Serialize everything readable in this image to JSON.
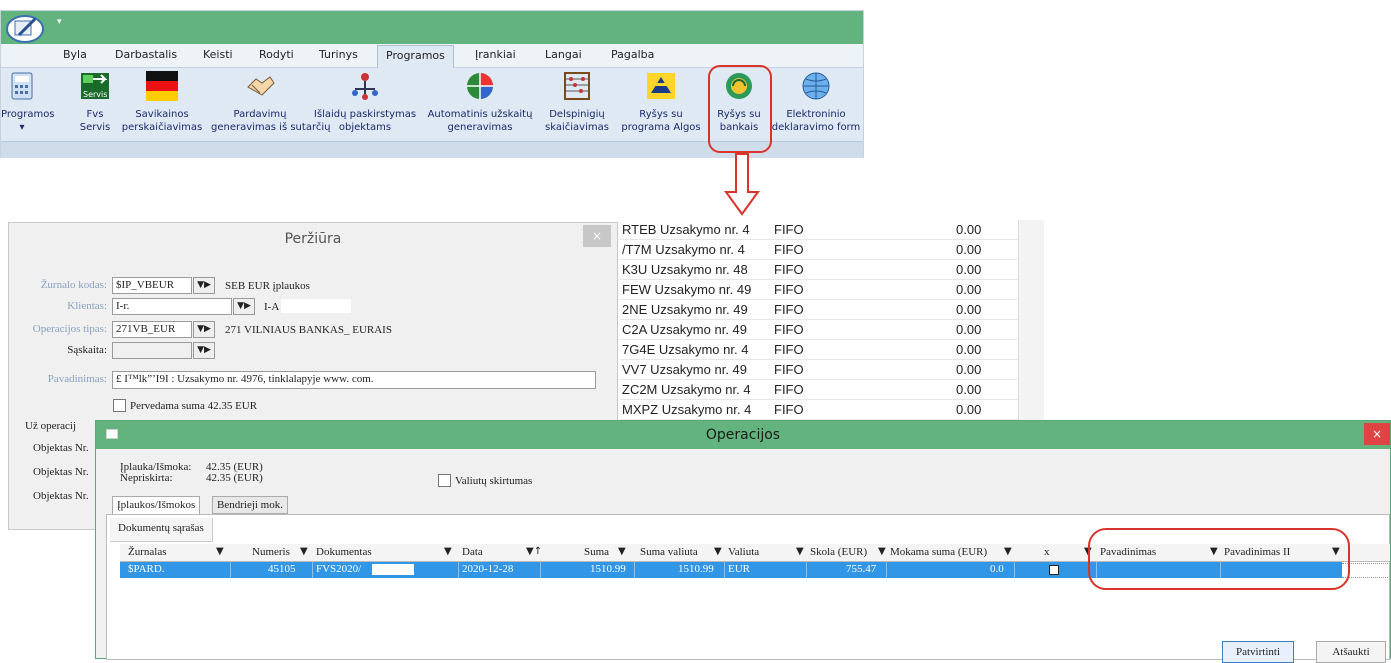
{
  "ribbon": {
    "tabs": [
      "Byla",
      "Darbastalis",
      "Keisti",
      "Rodyti",
      "Turinys",
      "Programos",
      "Įrankiai",
      "Langai",
      "Pagalba"
    ],
    "active_tab": "Programos",
    "buttons": [
      {
        "line1": "Programos",
        "line2": "",
        "icon": "calculator-icon"
      },
      {
        "line1": "Fvs",
        "line2": "Servis",
        "icon": "fvs-servis-icon"
      },
      {
        "line1": "Savikainos",
        "line2": "perskaičiavimas",
        "icon": "flag-icon"
      },
      {
        "line1": "Pardavimų",
        "line2": "generavimas iš sutarčių",
        "icon": "handshake-icon"
      },
      {
        "line1": "Išlaidų paskirstymas",
        "line2": "objektams",
        "icon": "distribution-icon"
      },
      {
        "line1": "Automatinis užskaitų",
        "line2": "generavimas",
        "icon": "pie-icon"
      },
      {
        "line1": "Delspinigių",
        "line2": "skaičiavimas",
        "icon": "abacus-icon"
      },
      {
        "line1": "Ryšys su",
        "line2": "programa Algos",
        "icon": "algos-icon"
      },
      {
        "line1": "Ryšys su",
        "line2": "bankais",
        "icon": "bank-link-icon"
      },
      {
        "line1": "Elektroninio",
        "line2": "deklaravimo form",
        "icon": "globe-icon"
      }
    ]
  },
  "perziura": {
    "title": "Peržiūra",
    "close": "×",
    "zurnalo_label": "Žurnalo kodas:",
    "zurnalo_value": "$IP_VBEUR",
    "zurnalo_desc": "SEB EUR įplaukos",
    "klientas_label": "Klientas:",
    "klientas_value": "I-г.",
    "klientas_desc": "I-A",
    "op_tipas_label": "Operacijos tipas:",
    "op_tipas_value": "271VB_EUR",
    "op_tipas_desc": "271 VILNIAUS BANKAS_ EURAIS",
    "saskaita_label": "Sąskaita:",
    "pavadinimas_label": "Pavadinimas:",
    "pavadinimas_value": "£ I™lk”’I9I  : Uzsakymo nr. 4976, tinklalapyje www.                 com.",
    "pervedama": "Pervedama suma 42.35 EUR",
    "uz_operacij": "Už operacij",
    "objektas": "Objektas Nr."
  },
  "fifo_list": [
    {
      "code": "RTEB Uzsakymo nr. 4",
      "method": "FIFO",
      "amount": "0.00"
    },
    {
      "code": "/T7M Uzsakymo nr. 4",
      "method": "FIFO",
      "amount": "0.00"
    },
    {
      "code": "K3U Uzsakymo nr. 48",
      "method": "FIFO",
      "amount": "0.00"
    },
    {
      "code": "FEW Uzsakymo nr. 49",
      "method": "FIFO",
      "amount": "0.00"
    },
    {
      "code": "2NE Uzsakymo nr. 49",
      "method": "FIFO",
      "amount": "0.00"
    },
    {
      "code": "C2A Uzsakymo nr. 49",
      "method": "FIFO",
      "amount": "0.00"
    },
    {
      "code": "7G4E Uzsakymo nr. 4",
      "method": "FIFO",
      "amount": "0.00"
    },
    {
      "code": "VV7 Uzsakymo nr. 49",
      "method": "FIFO",
      "amount": "0.00"
    },
    {
      "code": "ZC2M Uzsakymo nr. 4",
      "method": "FIFO",
      "amount": "0.00"
    },
    {
      "code": "MXPZ Uzsakymo nr. 4",
      "method": "FIFO",
      "amount": "0.00"
    }
  ],
  "operacijos": {
    "title": "Operacijos",
    "close": "×",
    "iplauka_label": "Įplauka/Išmoka:",
    "iplauka_value": "42.35 (EUR)",
    "nepriskirta_label": "Nepriskirta:",
    "nepriskirta_value": "42.35 (EUR)",
    "valiutu_skirtumas": "Valiutų skirtumas",
    "tabs": [
      "Įplaukos/Išmokos",
      "Bendrieji mok."
    ],
    "doc_list": "Dokumentų sąrašas",
    "columns": [
      "Žurnalas",
      "Numeris",
      "Dokumentas",
      "Data",
      "Suma",
      "Suma valiuta",
      "Valiuta",
      "Skola (EUR)",
      "Mokama suma (EUR)",
      "x",
      "Pavadinimas",
      "Pavadinimas II"
    ],
    "row": {
      "zurnalas": "$PARD.",
      "numeris": "45105",
      "dokumentas": "FVS2020/",
      "data": "2020-12-28",
      "suma": "1510.99",
      "suma_valiuta": "1510.99",
      "valiuta": "EUR",
      "skola": "755.47",
      "mokama": "0.0"
    },
    "confirm": "Patvirtinti",
    "cancel": "Atšaukti"
  }
}
